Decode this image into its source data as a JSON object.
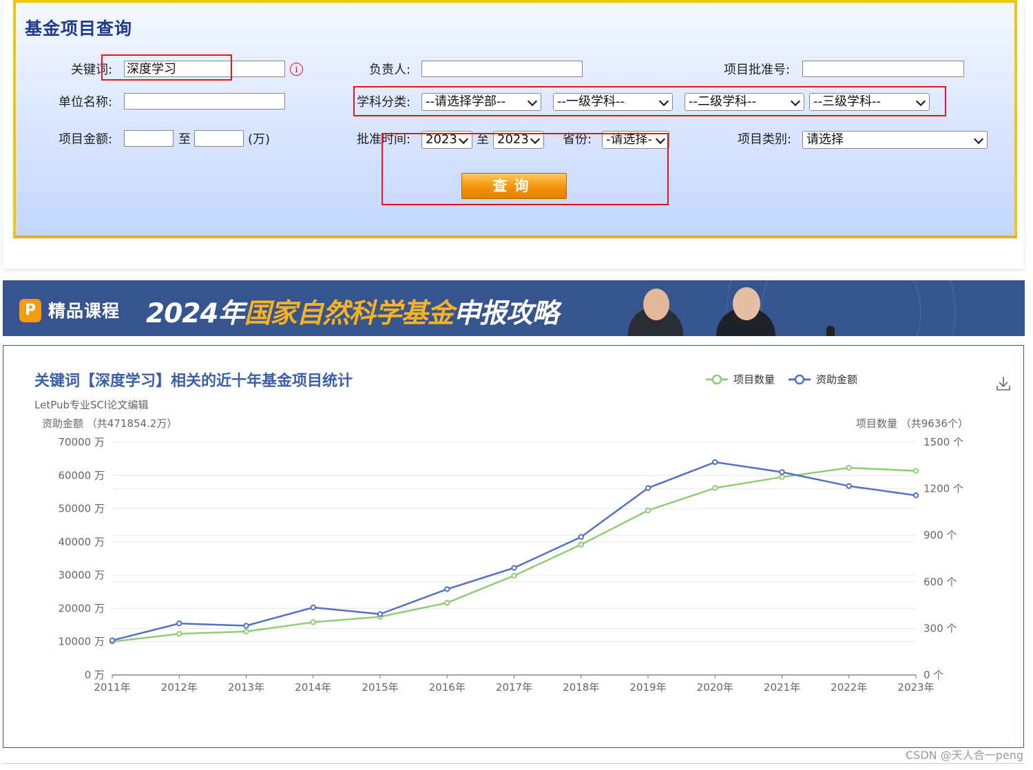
{
  "form": {
    "title": "基金项目查询",
    "keyword": {
      "label": "关键词:",
      "value": "深度学习"
    },
    "leader": {
      "label": "负责人:",
      "value": ""
    },
    "approval_no": {
      "label": "项目批准号:",
      "value": ""
    },
    "org": {
      "label": "单位名称:",
      "value": ""
    },
    "subject": {
      "label": "学科分类:",
      "dept": "--请选择学部--",
      "level1": "--一级学科--",
      "level2": "--二级学科--",
      "level3": "--三级学科--"
    },
    "amount": {
      "label": "项目金额:",
      "from": "",
      "to_label": "至",
      "to": "",
      "unit": "(万)"
    },
    "approve_time": {
      "label": "批准时间:",
      "from": "2023",
      "to_label": "至",
      "to": "2023"
    },
    "province": {
      "label": "省份:",
      "value": "-请选择-"
    },
    "category": {
      "label": "项目类别:",
      "value": "请选择"
    },
    "search_label": "查询"
  },
  "banner": {
    "brand_icon": "P",
    "brand": "精品课程",
    "headline_parts": [
      "2024年",
      "国家自然科学基金",
      "申报攻略"
    ],
    "colors": {
      "bg": "#36558f",
      "highlight": "#f5b324"
    }
  },
  "chart_data": {
    "type": "line",
    "title": "关键词【深度学习】相关的近十年基金项目统计",
    "subtitle": "LetPub专业SCI论文编辑",
    "left_axis_label": "资助金额 （共471854.2万）",
    "right_axis_label": "项目数量 （共9636个）",
    "x": [
      "2011年",
      "2012年",
      "2013年",
      "2014年",
      "2015年",
      "2016年",
      "2017年",
      "2018年",
      "2019年",
      "2020年",
      "2021年",
      "2022年",
      "2023年"
    ],
    "left_ticks": [
      "0 万",
      "10000 万",
      "20000 万",
      "30000 万",
      "40000 万",
      "50000 万",
      "60000 万",
      "70000 万"
    ],
    "right_ticks": [
      "0 个",
      "300 个",
      "600 个",
      "900 个",
      "1200 个",
      "1500 个"
    ],
    "ylim_left": [
      0,
      70000
    ],
    "ylim_right": [
      0,
      1500
    ],
    "legend_position": "top-right",
    "series": [
      {
        "name": "项目数量",
        "axis": "right",
        "color": "#91cc75",
        "values": [
          215,
          265,
          280,
          340,
          375,
          465,
          640,
          840,
          1060,
          1205,
          1275,
          1335,
          1315
        ]
      },
      {
        "name": "资助金额",
        "axis": "left",
        "color": "#5470c6",
        "values": [
          10400,
          15500,
          14800,
          20300,
          18300,
          25800,
          32200,
          41500,
          56200,
          64000,
          61000,
          56800,
          54000
        ]
      }
    ]
  },
  "watermark": "CSDN @天人合一peng"
}
